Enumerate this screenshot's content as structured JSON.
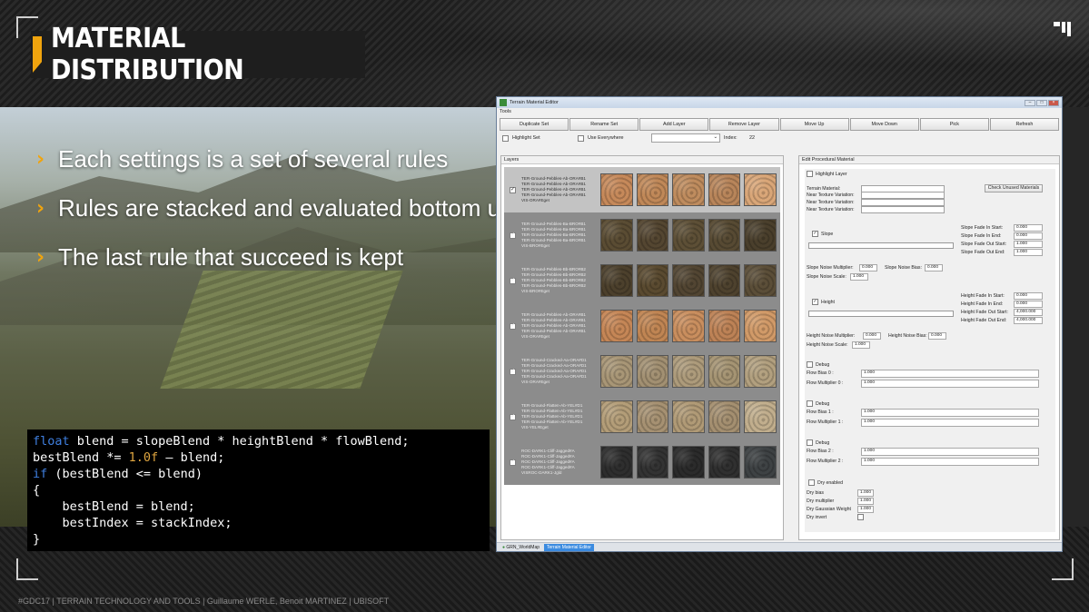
{
  "slide": {
    "title": "MATERIAL DISTRIBUTION",
    "bullets": [
      "Each settings is a set of several rules",
      "Rules are stacked and evaluated bottom up",
      "The last rule that succeed is kept"
    ],
    "bullet_glyph": "›",
    "footer": "#GDC17 | TERRAIN TECHNOLOGY AND TOOLS | Guillaume WERLE, Benoit MARTINEZ | UBISOFT",
    "accent_color": "#f0a40e"
  },
  "code": {
    "line1": [
      "float",
      " blend = slopeBlend * heightBlend * flowBlend;"
    ],
    "line2": [
      "bestBlend *= ",
      "1.0f",
      " – blend;"
    ],
    "line3": [
      "if",
      " (bestBlend <= blend)"
    ],
    "line4": "{",
    "line5": "    bestBlend = blend;",
    "line6": "    bestIndex = stackIndex;",
    "line7": "}"
  },
  "window": {
    "title": "Terrain Material Editor",
    "menu": "Tools",
    "toolbar": [
      "Duplicate Set",
      "Rename Set",
      "Add Layer",
      "Remove Layer",
      "Move Up",
      "Move Down",
      "Pick",
      "Refresh"
    ],
    "highlight_set": "Highlight Set",
    "use_everywhere": "Use Everywhere",
    "index_label": "Index:",
    "index_value": "22",
    "layers_header": "Layers",
    "layers": [
      {
        "lines": [
          "TER-Ground-Pebbles-Ab-ORA#B1",
          "TER-Ground-Pebbles-Ab-ORA#B1",
          "TER-Ground-Pebbles-Ab-ORA#B1",
          "TER-Ground-Pebbles-Ab-ORA#B1",
          "VIS-ORA#Eget"
        ],
        "colors": [
          "#c6895a",
          "#c08858",
          "#bf8c5e",
          "#b8855a",
          "#d9a678"
        ],
        "selected": true
      },
      {
        "lines": [
          "TER-Ground-Pebbles-Ba-BRO#B1",
          "TER-Ground-Pebbles-Ba-BRO#B1",
          "TER-Ground-Pebbles-Ba-BRO#B1",
          "TER-Ground-Pebbles-Ba-BRO#B1",
          "VIS-BRO#Eget"
        ],
        "colors": [
          "#5a4c33",
          "#544631",
          "#5d4f36",
          "#574a33",
          "#4a3f2c"
        ],
        "selected": false
      },
      {
        "lines": [
          "TER-Ground-Pebbles-Bb-BRO#B2",
          "TER-Ground-Pebbles-Bb-BRO#B2",
          "TER-Ground-Pebbles-Bb-BRO#B2",
          "TER-Ground-Pebbles-Bb-BRO#B2",
          "VIS-BRO#Eget"
        ],
        "colors": [
          "#4c402c",
          "#5a4a30",
          "#524532",
          "#4e422e",
          "#5b4e38"
        ],
        "selected": false
      },
      {
        "lines": [
          "TER-Ground-Pebbles-Ab-ORA#B1",
          "TER-Ground-Pebbles-Ab-ORA#B1",
          "TER-Ground-Pebbles-Ab-ORA#B1",
          "TER-Ground-Pebbles-Ab-ORA#B1",
          "VIS-ORA#Eget"
        ],
        "colors": [
          "#c58656",
          "#c08553",
          "#c98e5e",
          "#bd8256",
          "#d19a68"
        ],
        "selected": false
      },
      {
        "lines": [
          "TER-Ground-Cracked-Aa-ORA#D1",
          "TER-Ground-Cracked-Aa-ORA#D1",
          "TER-Ground-Cracked-Aa-ORA#D1",
          "TER-Ground-Cracked-Aa-ORA#D1",
          "VIS-ORA#Eget"
        ],
        "colors": [
          "#a89676",
          "#a29072",
          "#ad9b7b",
          "#a59473",
          "#b2a07f"
        ],
        "selected": false
      },
      {
        "lines": [
          "TER-Ground-Flatten-Ab-YEL#D1",
          "TER-Ground-Flatten-Ab-YEL#D1",
          "TER-Ground-Flatten-Ab-YEL#D1",
          "TER-Ground-Flatten-Ab-YEL#D1",
          "VIS-YEL#Eget"
        ],
        "colors": [
          "#b39d78",
          "#a69172",
          "#b09a76",
          "#a48f70",
          "#c1ae8d"
        ],
        "selected": false
      },
      {
        "lines": [
          "ROC-DARK1-Cliff-Jagged#A",
          "ROC-DARK1-Cliff-Jagged#A",
          "ROC-DARK1-Cliff-Jagged#A",
          "ROC-DARK1-Cliff-Jagged#A",
          "VISROC-DARK1-Jgld"
        ],
        "colors": [
          "#2e2e2e",
          "#333333",
          "#2b2b2b",
          "#303030",
          "#3e4244"
        ],
        "selected": false
      }
    ],
    "right_header": "Edit Procedural Material",
    "highlight_layer": "Highlight Layer",
    "terrain_material": "Terrain Material:",
    "near_variations": [
      "Near Texture Variation:",
      "Near Texture Variation:",
      "Near Texture Variation:"
    ],
    "check_unused": "Check Unused Materials",
    "slope": {
      "label": "Slope",
      "fade_labels": [
        "Slope Fade In Start:",
        "Slope Fade In End:",
        "Slope Fade Out Start:",
        "Slope Fade Out End:"
      ],
      "fade_values": [
        "0.000",
        "0.000",
        "1.000",
        "1.000"
      ],
      "noise_mult_label": "Slope Noise Multiplier:",
      "noise_mult": "0.000",
      "noise_bias_label": "Slope Noise Bias:",
      "noise_bias": "0.000",
      "noise_scale_label": "Slope Noise Scale:",
      "noise_scale": "1.000"
    },
    "height": {
      "label": "Height",
      "fade_labels": [
        "Height Fade In Start:",
        "Height Fade In End:",
        "Height Fade Out Start:",
        "Height Fade Out End:"
      ],
      "fade_values": [
        "0.000",
        "0.000",
        "4,000.000",
        "4,000.000"
      ],
      "noise_mult_label": "Height Noise Multiplier:",
      "noise_mult": "0.000",
      "noise_bias_label": "Height Noise Bias:",
      "noise_bias": "0.000",
      "noise_scale_label": "Height Noise Scale:",
      "noise_scale": "1.000"
    },
    "debug_groups": [
      {
        "label": "Debug",
        "bias_label": "Flow Bias 0 :",
        "bias": "1.000",
        "mult_label": "Flow Multiplier 0 :",
        "mult": "1.000"
      },
      {
        "label": "Debug",
        "bias_label": "Flow Bias 1 :",
        "bias": "1.000",
        "mult_label": "Flow Multiplier 1 :",
        "mult": "1.000"
      },
      {
        "label": "Debug",
        "bias_label": "Flow Bias 2 :",
        "bias": "1.000",
        "mult_label": "Flow Multiplier 2 :",
        "mult": "1.000"
      }
    ],
    "dry": {
      "label": "Dry enabled",
      "bias_label": "Dry bias",
      "bias": "1.000",
      "mult_label": "Dry multiplier",
      "mult": "1.000",
      "gauss_label": "Dry Gaussian Weight",
      "gauss": "1.000",
      "invert_label": "Dry invert"
    },
    "tasks": [
      "GRN_WorldMap",
      "Terrain Material Editor"
    ]
  }
}
